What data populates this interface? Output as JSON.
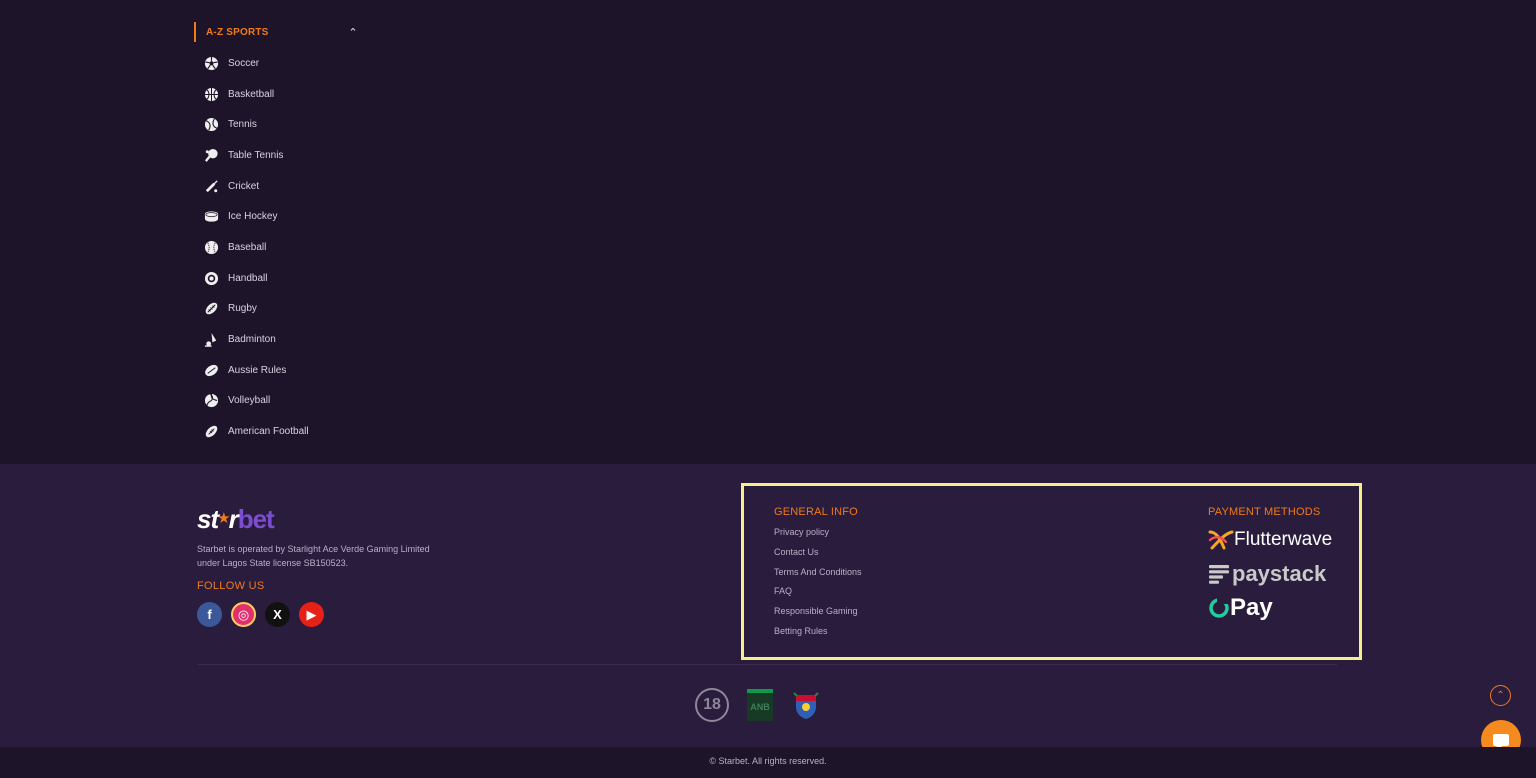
{
  "az_sports": {
    "title": "A-Z SPORTS",
    "items": [
      {
        "label": "Soccer",
        "icon": "soccer-ball-icon"
      },
      {
        "label": "Basketball",
        "icon": "basketball-icon"
      },
      {
        "label": "Tennis",
        "icon": "tennis-ball-icon"
      },
      {
        "label": "Table Tennis",
        "icon": "table-tennis-paddle-icon"
      },
      {
        "label": "Cricket",
        "icon": "cricket-bat-icon"
      },
      {
        "label": "Ice Hockey",
        "icon": "hockey-puck-icon"
      },
      {
        "label": "Baseball",
        "icon": "baseball-icon"
      },
      {
        "label": "Handball",
        "icon": "handball-icon"
      },
      {
        "label": "Rugby",
        "icon": "rugby-ball-icon"
      },
      {
        "label": "Badminton",
        "icon": "shuttlecock-icon"
      },
      {
        "label": "Aussie Rules",
        "icon": "aussie-rules-ball-icon"
      },
      {
        "label": "Volleyball",
        "icon": "volleyball-icon"
      },
      {
        "label": "American Football",
        "icon": "american-football-icon"
      }
    ]
  },
  "footer": {
    "logo": {
      "part1": "st",
      "part2": "r",
      "part3": "bet"
    },
    "operated_by": "Starbet is operated by Starlight Ace Verde Gaming Limited under Lagos State license SB150523.",
    "follow_us": "FOLLOW US",
    "socials": [
      {
        "name": "facebook",
        "glyph": "f"
      },
      {
        "name": "instagram",
        "glyph": "◎"
      },
      {
        "name": "x",
        "glyph": "X"
      },
      {
        "name": "youtube",
        "glyph": "▶"
      }
    ],
    "general_info": {
      "title": "GENERAL INFO",
      "links": [
        "Privacy policy",
        "Contact Us",
        "Terms And Conditions",
        "FAQ",
        "Responsible Gaming",
        "Betting Rules"
      ]
    },
    "payment_methods": {
      "title": "PAYMENT METHODS",
      "items": [
        "Flutterwave",
        "paystack",
        "Pay"
      ]
    },
    "badges": {
      "age": "18"
    },
    "copyright": "© Starbet. All rights reserved."
  },
  "colors": {
    "accent": "#f07a1a",
    "highlight_border": "#f7ef8a",
    "background": "#1e1429",
    "footer": "#2a1c3d"
  }
}
